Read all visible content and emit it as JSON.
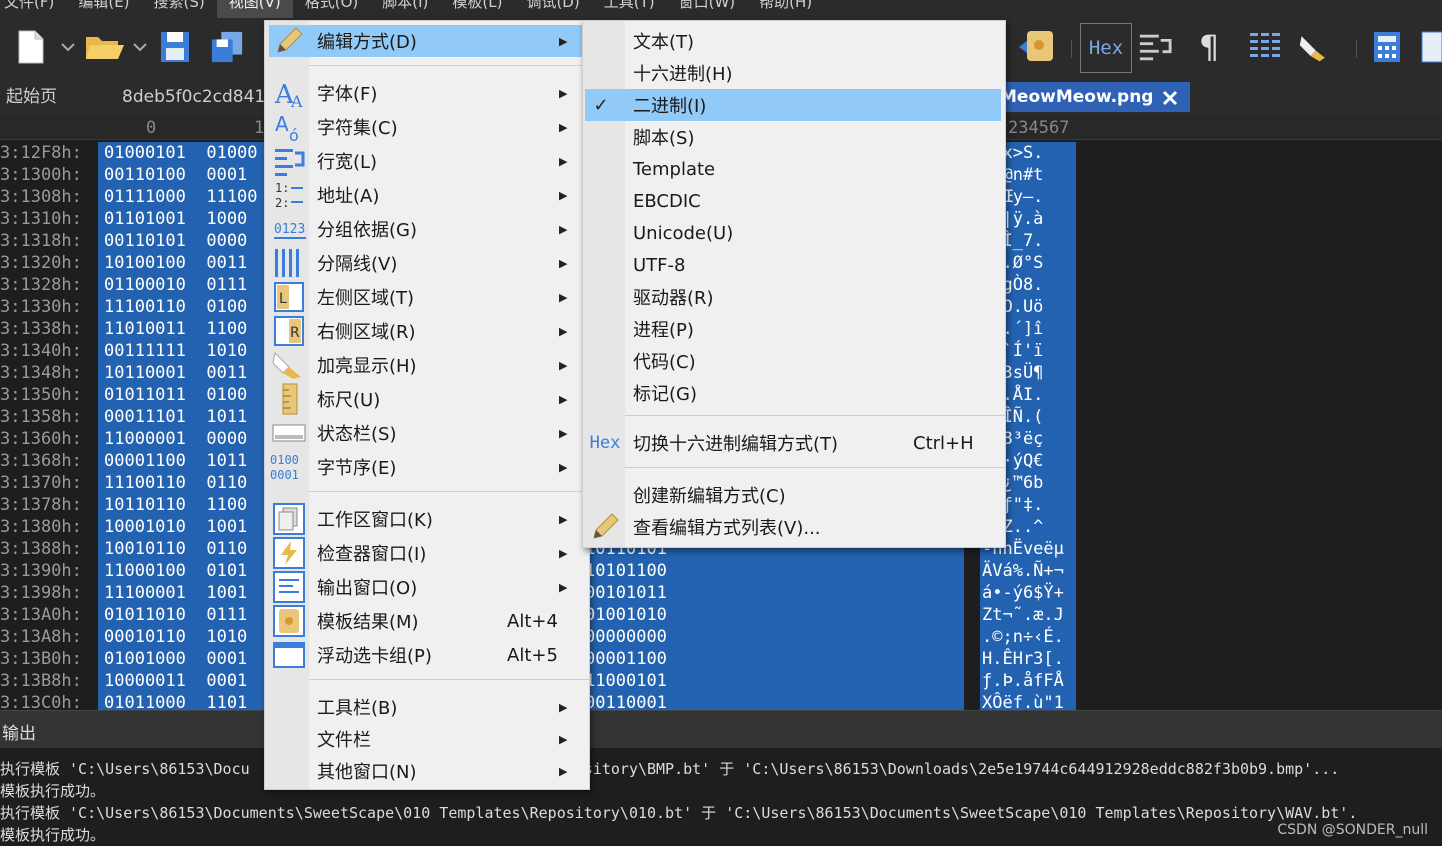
{
  "menubar": {
    "items": [
      "文件(F)",
      "编辑(E)",
      "搜索(S)",
      "视图(V)",
      "格式(O)",
      "脚本(I)",
      "模板(L)",
      "调试(D)",
      "工具(T)",
      "窗口(W)",
      "帮助(H)"
    ]
  },
  "toolbar": {
    "hex_label": "Hex",
    "pilcrow": "¶"
  },
  "tabs": {
    "start": "起始页",
    "file1": "8deb5f0c2cd841",
    "file2": "MeowMeow.png"
  },
  "ruler": {
    "left": "0",
    "mid": "1",
    "right": "234567"
  },
  "hex_rows": [
    {
      "addr": "3:12F8h:",
      "bin": "01000101  01000",
      "ascii": "-Õx>S."
    },
    {
      "addr": "3:1300h:",
      "bin": "00110100  0001",
      "ascii": "ÏH@n#t"
    },
    {
      "addr": "3:1308h:",
      "bin": "01111000  11100",
      "ascii": "{\"Œy–."
    },
    {
      "addr": "3:1310h:",
      "bin": "01101001  1000",
      "ascii": ".Ÿ|ÿ.à"
    },
    {
      "addr": "3:1318h:",
      "bin": "00110101  0000",
      "ascii": "Ý²Ì_7."
    },
    {
      "addr": "3:1320h:",
      "bin": "10100100  0011",
      "ascii": "‰1.Ø°S"
    },
    {
      "addr": "3:1328h:",
      "bin": "01100010  0111",
      "ascii": ")?gÒ8."
    },
    {
      "addr": "3:1330h:",
      "bin": "11100110  0100",
      "ascii": "PIO.Uö"
    },
    {
      "addr": "3:1338h:",
      "bin": "11010011  1100",
      "ascii": "¾..´]î"
    },
    {
      "addr": "3:1340h:",
      "bin": "00111111  1010",
      "ascii": "/^`Í'ï"
    },
    {
      "addr": "3:1348h:",
      "bin": "10110001  0011",
      "ascii": "“ë3sÜ¶"
    },
    {
      "addr": "3:1350h:",
      "bin": "01011011  0100",
      "ascii": "ÿç.ÅI."
    },
    {
      "addr": "3:1358h:",
      "bin": "00011101  1011",
      "ascii": "ì9ÎÑ.("
    },
    {
      "addr": "3:1360h:",
      "bin": "11000001  0000",
      "ascii": "m.8³ëç"
    },
    {
      "addr": "3:1368h:",
      "bin": "00001100  1011",
      "ascii": "uÂ·ýQ€"
    },
    {
      "addr": "3:1370h:",
      "bin": "11100110  0110",
      "ascii": "ì7¿™6b"
    },
    {
      "addr": "3:1378h:",
      "bin": "10110110  1100",
      "ascii": ".qƒ\"‡."
    },
    {
      "addr": "3:1380h:",
      "bin": "10001010  1001",
      "ascii": ".ëZ..^"
    },
    {
      "addr": "3:1388h:",
      "bin": "10010110  0110       0110  01100101  11101011  10110101",
      "ascii": "-nnËveëµ"
    },
    {
      "addr": "3:1390h:",
      "bin": "11000100  0101       0110  11010001  00101011  10101100",
      "ascii": "ÄVá%.Ñ+¬"
    },
    {
      "addr": "3:1398h:",
      "bin": "11100001  1001       0110  00100100  10011111  00101011",
      "ascii": "á•-ý6$Ÿ+"
    },
    {
      "addr": "3:13A0h:",
      "bin": "01011010  0111       0001  11100110  00011110  01001010",
      "ascii": "Zt¬˜.æ.J"
    },
    {
      "addr": "3:13A8h:",
      "bin": "00010110  1010       0111  10001011  11001001  00000000",
      "ascii": ".©;n÷‹É."
    },
    {
      "addr": "3:13B0h:",
      "bin": "01001000  0001       0010  00110011  01011011  00001100",
      "ascii": "H.ÊHr3[."
    },
    {
      "addr": "3:13B8h:",
      "bin": "10000011  0001       0101  01100110  01000110  11000101",
      "ascii": "ƒ.Þ.åfFÅ"
    },
    {
      "addr": "3:13C0h:",
      "bin": "01011000  1101       0001  11111001  00100010  00110001",
      "ascii": "XÔëf.ù\"1"
    }
  ],
  "output": {
    "title": "输出",
    "lines": [
      "执行模板 'C:\\Users\\86153\\Docu                                  epository\\BMP.bt' 于 'C:\\Users\\86153\\Downloads\\2e5e19744c644912928eddc882f3b0b9.bmp'...",
      "模板执行成功。",
      "执行模板 'C:\\Users\\86153\\Documents\\SweetScape\\010 Templates\\Repository\\010.bt' 于 'C:\\Users\\86153\\Documents\\SweetScape\\010 Templates\\Repository\\WAV.bt'.",
      "模板执行成功。"
    ],
    "watermark": "CSDN @SONDER_null"
  },
  "view_menu": {
    "items": [
      {
        "label": "编辑方式(D)",
        "icon": "pencil-icon",
        "submenu": true
      },
      {
        "label": "字体(F)",
        "icon": "font-icon",
        "submenu": true
      },
      {
        "label": "字符集(C)",
        "icon": "charset-icon",
        "submenu": true
      },
      {
        "label": "行宽(L)",
        "icon": "line-width-icon",
        "submenu": true
      },
      {
        "label": "地址(A)",
        "icon": "address-icon",
        "submenu": true
      },
      {
        "label": "分组依据(G)",
        "icon": "group-icon",
        "submenu": true
      },
      {
        "label": "分隔线(V)",
        "icon": "divider-lines-icon",
        "submenu": true
      },
      {
        "label": "左侧区域(T)",
        "icon": "left-area-icon",
        "submenu": true
      },
      {
        "label": "右侧区域(R)",
        "icon": "right-area-icon",
        "submenu": true
      },
      {
        "label": "加亮显示(H)",
        "icon": "highlight-icon",
        "submenu": true
      },
      {
        "label": "标尺(U)",
        "icon": "ruler-icon",
        "submenu": true
      },
      {
        "label": "状态栏(S)",
        "icon": "status-bar-icon",
        "submenu": true
      },
      {
        "label": "字节序(E)",
        "icon": "byte-order-icon",
        "submenu": true
      },
      {
        "label": "工作区窗口(K)",
        "icon": "workspace-icon",
        "submenu": true
      },
      {
        "label": "检查器窗口(I)",
        "icon": "inspector-icon",
        "submenu": true
      },
      {
        "label": "输出窗口(O)",
        "icon": "output-icon",
        "submenu": true
      },
      {
        "label": "模板结果(M)",
        "icon": "template-results-icon",
        "shortcut": "Alt+4"
      },
      {
        "label": "浮动选卡组(P)",
        "icon": "floating-tabs-icon",
        "shortcut": "Alt+5"
      },
      {
        "label": "工具栏(B)",
        "submenu": true
      },
      {
        "label": "文件栏",
        "submenu": true
      },
      {
        "label": "其他窗口(N)",
        "submenu": true
      }
    ],
    "icon_text": {
      "charset": "A",
      "address": "1:\n2:",
      "group": "0123",
      "byte_order": "0100\n0001",
      "left": "L",
      "right": "R"
    }
  },
  "edit_submenu": {
    "items": [
      {
        "label": "文本(T)"
      },
      {
        "label": "十六进制(H)"
      },
      {
        "label": "二进制(I)",
        "checked": true
      },
      {
        "label": "脚本(S)"
      },
      {
        "label": "Template"
      },
      {
        "label": "EBCDIC"
      },
      {
        "label": "Unicode(U)"
      },
      {
        "label": "UTF-8"
      },
      {
        "label": "驱动器(R)"
      },
      {
        "label": "进程(P)"
      },
      {
        "label": "代码(C)"
      },
      {
        "label": "标记(G)"
      },
      {
        "label": "切换十六进制编辑方式(T)",
        "shortcut": "Ctrl+H",
        "icon_text": "Hex"
      },
      {
        "label": "创建新编辑方式(C)"
      },
      {
        "label": "查看编辑方式列表(V)...",
        "icon": "pencil-icon"
      }
    ],
    "check_glyph": "✓"
  },
  "colors": {
    "selection_blue": "#2362b0",
    "menu_highlight": "#91c9f7",
    "menu_bg": "#f0f0f0",
    "active_tab": "#2f62b5"
  }
}
